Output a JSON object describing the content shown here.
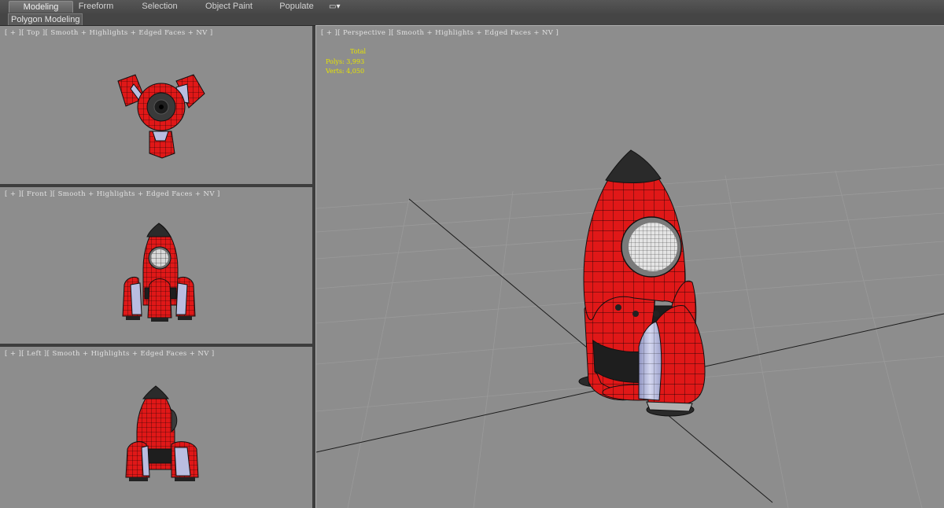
{
  "ribbon": {
    "tabs": [
      {
        "label": "Modeling",
        "active": true
      },
      {
        "label": "Freeform",
        "active": false
      },
      {
        "label": "Selection",
        "active": false
      },
      {
        "label": "Object Paint",
        "active": false
      },
      {
        "label": "Populate",
        "active": false
      }
    ],
    "options_glyph": "▭▾"
  },
  "subribbon": {
    "label": "Polygon Modeling"
  },
  "viewports": {
    "top": {
      "label": "[ + ][ Top ][ Smooth + Highlights + Edged Faces + NV ]"
    },
    "front": {
      "label": "[ + ][ Front ][ Smooth + Highlights + Edged Faces + NV ]"
    },
    "left": {
      "label": "[ + ][ Left ][ Smooth + Highlights + Edged Faces + NV ]"
    },
    "perspective": {
      "label": "[ + ][ Perspective ][ Smooth + Highlights + Edged Faces + NV ]",
      "stats": {
        "total": "Total",
        "polys": "Polys: 3,993",
        "verts": "Verts: 4,050"
      }
    }
  },
  "colors": {
    "viewport_bg": "#8d8d8d",
    "rocket_red": "#e01818",
    "rocket_nose": "#2b2b2b",
    "fin_metal": "#b9bde0",
    "stats_yellow": "#e6e400"
  }
}
